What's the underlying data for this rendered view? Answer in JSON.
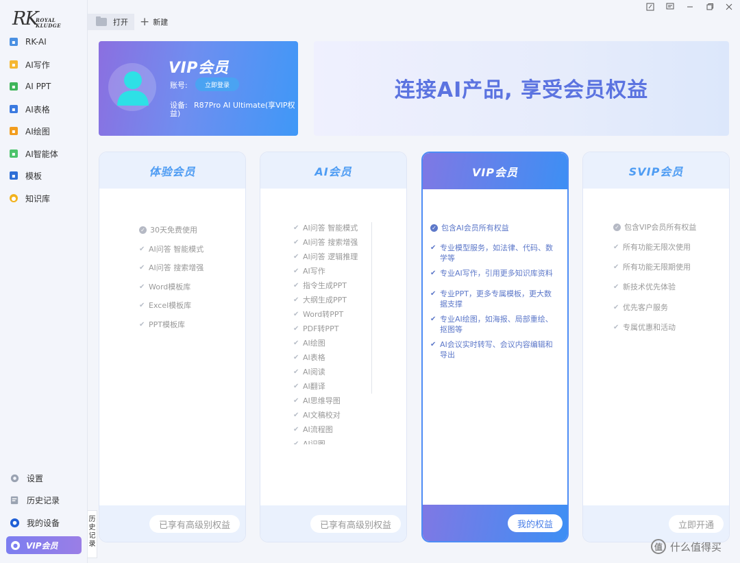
{
  "sidebar": {
    "logo_mark": "RK",
    "logo_brand_line1": "ROYAL",
    "logo_brand_line2": "KLUDGE",
    "items": [
      {
        "label": "RK-AI",
        "icon": "rk-ai-icon",
        "color": "#4a90e2"
      },
      {
        "label": "AI写作",
        "icon": "writing-icon",
        "color": "#f5b731"
      },
      {
        "label": "AI PPT",
        "icon": "ppt-icon",
        "color": "#3fb55a"
      },
      {
        "label": "AI表格",
        "icon": "table-icon",
        "color": "#3b7ae0"
      },
      {
        "label": "AI绘图",
        "icon": "drawing-icon",
        "color": "#f29d1e"
      },
      {
        "label": "AI智能体",
        "icon": "agent-icon",
        "color": "#4cc36b"
      },
      {
        "label": "模板",
        "icon": "template-icon",
        "color": "#2f6fd6"
      },
      {
        "label": "知识库",
        "icon": "knowledge-icon",
        "color": "#f2b21e"
      }
    ],
    "bottom": {
      "settings": "设置",
      "history": "历史记录",
      "devices": "我的设备",
      "vip": "VIP会员"
    },
    "history_tab": [
      "历",
      "史",
      "记",
      "录"
    ]
  },
  "toolbar": {
    "open_label": "打开",
    "new_label": "新建"
  },
  "vip_card": {
    "title": "VIP会员",
    "account_label": "账号:",
    "login_button": "立即登录",
    "device_label": "设备:",
    "device_value_line1": "R87Pro AI Ultimate(享VIP权",
    "device_value_line2": "益)"
  },
  "banner": {
    "slogan": "连接AI产品, 享受会员权益"
  },
  "plans": [
    {
      "name": "体验会员",
      "features": [
        "30天免费使用",
        "AI问答 智能模式",
        "AI问答 搜索增强",
        "Word模板库",
        "Excel模板库",
        "PPT模板库"
      ],
      "button": "已享有高级别权益"
    },
    {
      "name": "AI会员",
      "features": [
        "AI问答 智能模式",
        "AI问答 搜索增强",
        "AI问答 逻辑推理",
        "AI写作",
        "指令生成PPT",
        "大纲生成PPT",
        "Word转PPT",
        "PDF转PPT",
        "AI绘图",
        "AI表格",
        "AI阅读",
        "AI翻译",
        "AI思维导图",
        "AI文稿校对",
        "AI流程图",
        "AI识图"
      ],
      "button": "已享有高级别权益"
    },
    {
      "name": "VIP会员",
      "features": [
        {
          "l1": "包含AI会员所有权益",
          "l2": ""
        },
        {
          "l1": "专业模型服务，如法律、代码、数",
          "l2": "学等"
        },
        {
          "l1": "专业AI写作，引用更多知识库资料",
          "l2": ""
        },
        {
          "l1": "专业PPT，更多专属模板，更大数",
          "l2": "据支撑"
        },
        {
          "l1": "专业AI绘图，如海报、局部重绘、",
          "l2": "抠图等"
        },
        {
          "l1": "AI会议实时转写、会议内容编辑和",
          "l2": "导出"
        }
      ],
      "button": "我的权益"
    },
    {
      "name": "SVIP会员",
      "features": [
        "包含VIP会员所有权益",
        "所有功能无限次使用",
        "所有功能无限期使用",
        "新技术优先体验",
        "优先客户服务",
        "专属优惠和活动"
      ],
      "button": "立即开通"
    }
  ],
  "watermark": "什么值得买",
  "colors": {
    "accent": "#4e9cf3",
    "vip_gradient_start": "#8b6fe0",
    "vip_gradient_end": "#3f98f7",
    "slogan": "#5b73e0"
  }
}
